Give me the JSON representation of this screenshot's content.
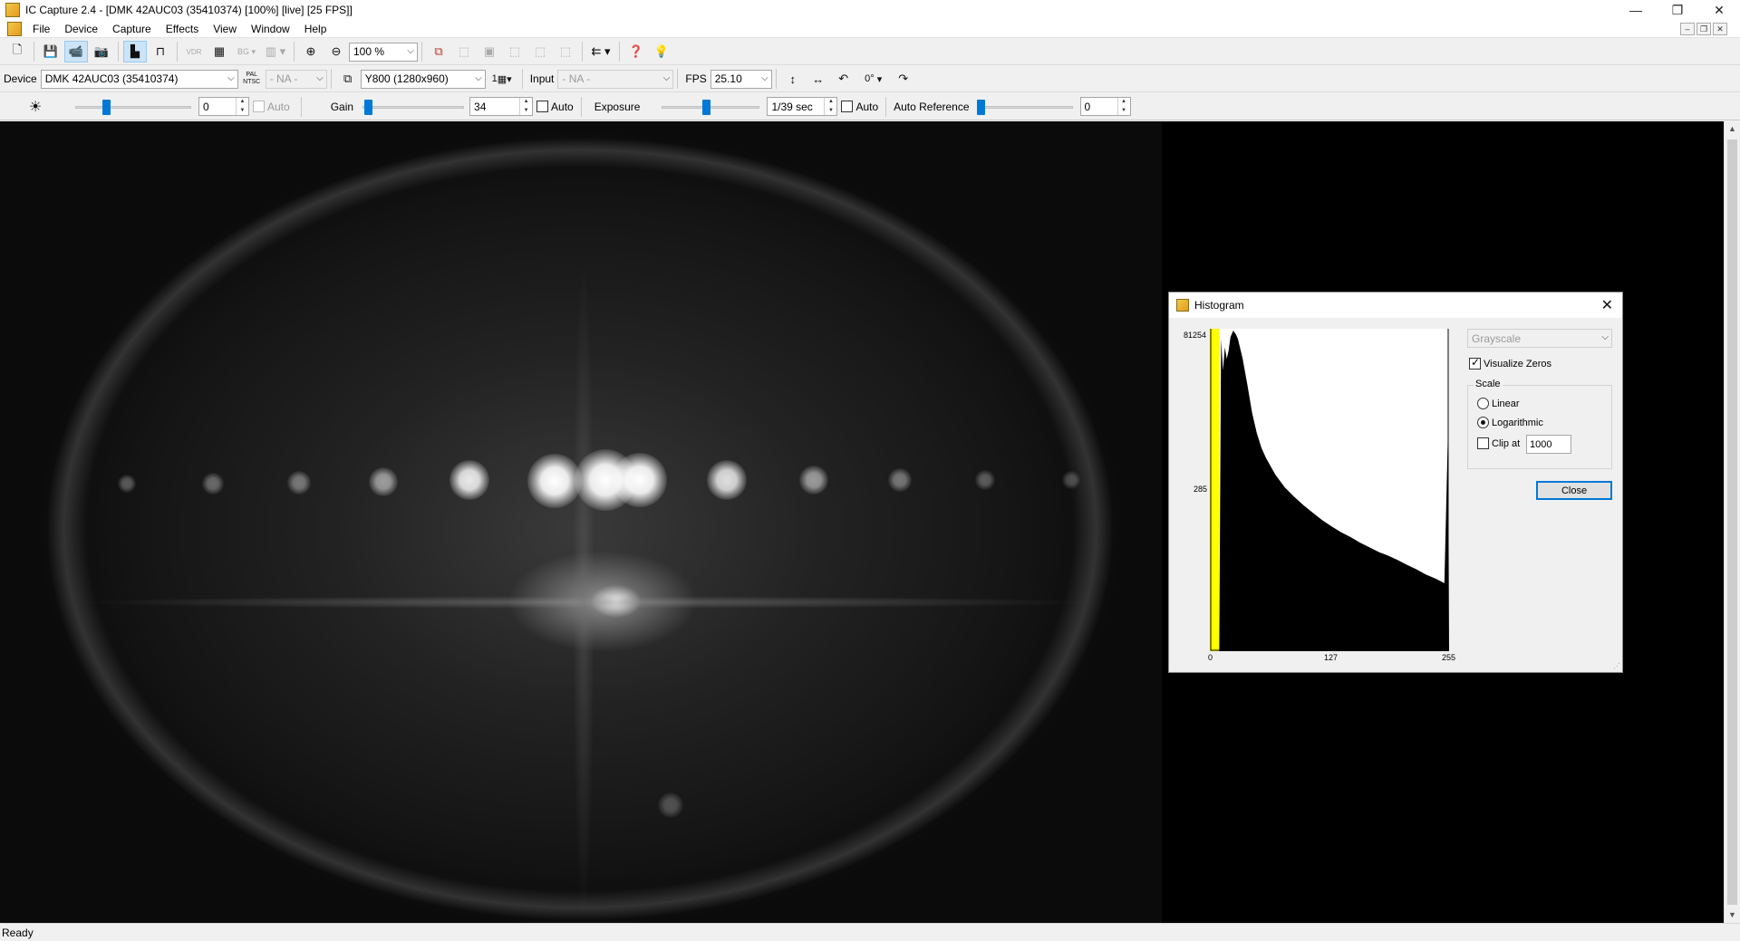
{
  "window": {
    "title": "IC Capture 2.4 - [DMK 42AUC03 (35410374) [100%]  [live]  [25 FPS]]",
    "controls": [
      "—",
      "❐",
      "✕"
    ]
  },
  "menu": {
    "items": [
      "File",
      "Device",
      "Capture",
      "Effects",
      "View",
      "Window",
      "Help"
    ],
    "mdi_controls": [
      "–",
      "❐",
      "✕"
    ]
  },
  "toolbar1": {
    "zoom": "100 %",
    "bg_label": "BG",
    "vdr_label": "VDR"
  },
  "toolbar2": {
    "device_label": "Device",
    "device_value": "DMK 42AUC03 (35410374)",
    "pal_label": "PAL NTSC",
    "pal_value": "- NA -",
    "format_value": "Y800 (1280x960)",
    "format_count": "1",
    "input_label": "Input",
    "input_value": "- NA -",
    "fps_label": "FPS",
    "fps_value": "25.10",
    "rotation": "0°"
  },
  "toolbar3": {
    "brightness_value": "0",
    "brightness_auto": "Auto",
    "brightness_level": 0.25,
    "gain_label": "Gain",
    "gain_value": "34",
    "gain_auto": "Auto",
    "gain_level": 0.02,
    "exposure_label": "Exposure",
    "exposure_value": "1/39 sec",
    "exposure_auto": "Auto",
    "exposure_level": 0.45,
    "autoref_label": "Auto Reference",
    "autoref_value": "0",
    "autoref_level": 0.0
  },
  "status": {
    "text": "Ready"
  },
  "histogram_dialog": {
    "title": "Histogram",
    "close_x": "✕",
    "channel": "Grayscale",
    "visualize_zeros": "Visualize Zeros",
    "visualize_zeros_checked": true,
    "scale_group": "Scale",
    "linear": "Linear",
    "logarithmic": "Logarithmic",
    "selected_scale": "Logarithmic",
    "clip_label": "Clip at",
    "clip_checked": false,
    "clip_value": "1000",
    "close_button": "Close",
    "highlight_color": "#ffff00"
  },
  "chart_data": {
    "type": "area",
    "y_ticks": [
      "81254",
      "285"
    ],
    "x_ticks": [
      "0",
      "127",
      "255"
    ],
    "xlim": [
      0,
      255
    ],
    "log_scale": true,
    "highlight_range": [
      0,
      10
    ],
    "x": [
      0,
      10,
      12,
      14,
      16,
      18,
      20,
      22,
      25,
      28,
      30,
      35,
      40,
      45,
      50,
      55,
      60,
      70,
      80,
      90,
      100,
      110,
      120,
      130,
      140,
      150,
      160,
      170,
      180,
      190,
      200,
      210,
      220,
      230,
      240,
      250,
      254,
      255
    ],
    "y": [
      0,
      0,
      60000,
      20000,
      45000,
      30000,
      40000,
      65000,
      81254,
      70000,
      60000,
      30000,
      12000,
      4500,
      2200,
      1300,
      900,
      500,
      320,
      230,
      170,
      130,
      100,
      80,
      65,
      55,
      45,
      38,
      32,
      28,
      24,
      20,
      17,
      14,
      12,
      10,
      3000,
      0
    ]
  }
}
